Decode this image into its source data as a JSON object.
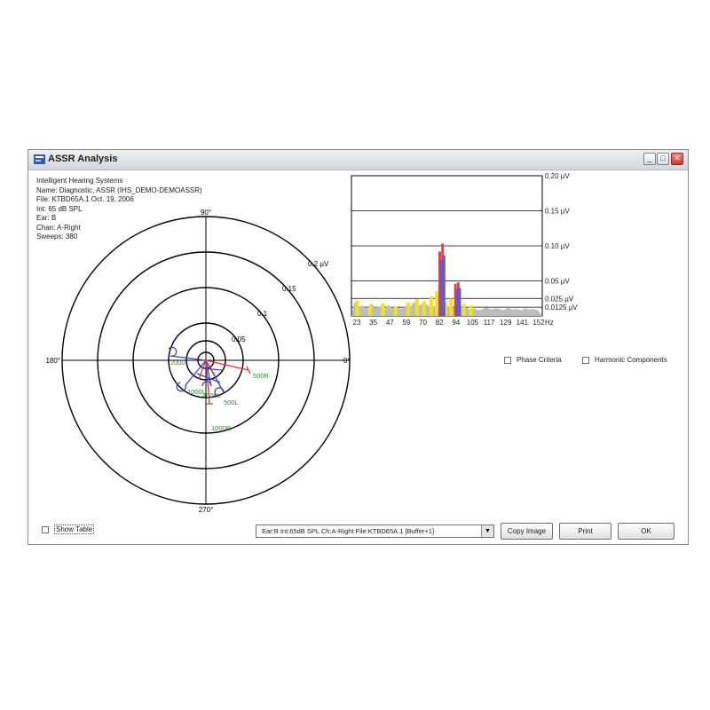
{
  "window": {
    "title": "ASSR Analysis",
    "minimize": "_",
    "maximize": "□",
    "close": "✕"
  },
  "info_lines": [
    "Intelligent Hearing Systems",
    "Name: Diagnostic, ASSR (IHS_DEMO-DEMOASSR)",
    "File: KTBD65A.1 Oct. 19, 2006",
    "Int: 65 dB SPL",
    "Ear: B",
    "Chan: A-Right",
    "Sweeps: 380"
  ],
  "polar": {
    "angle_labels": {
      "top": "90°",
      "left": "180°",
      "right": "0°",
      "bottom": "270°"
    },
    "ring_labels": [
      "0.05",
      "0.1",
      "0.15",
      "0.2 µV"
    ],
    "vector_labels": [
      {
        "text": "2000L",
        "color": "#2e8b2e"
      },
      {
        "text": "500R",
        "color": "#2e8b2e"
      },
      {
        "text": "1000L",
        "color": "#2e8b2e"
      },
      {
        "text": "4000L",
        "color": "#2e8b2e"
      },
      {
        "text": "500L",
        "color": "#2e8b2e"
      },
      {
        "text": "1000R",
        "color": "#2e8b2e"
      }
    ]
  },
  "chart_data": {
    "type": "bar",
    "x_tick_labels": [
      "23",
      "35",
      "47",
      "59",
      "70",
      "82",
      "94",
      "105",
      "117",
      "129",
      "141",
      "152"
    ],
    "x_unit": "Hz",
    "y_tick_labels": [
      "0.20 µV",
      "0.15 µV",
      "0.10 µV",
      "0.05 µV",
      "0.025 µV",
      "0.0125 µV"
    ],
    "ylim": [
      0,
      0.2
    ],
    "grid": true,
    "series": [
      {
        "values_hz": [
          82,
          84,
          93,
          95
        ],
        "values": [
          0.092,
          0.103,
          0.046,
          0.048
        ]
      },
      {
        "values_hz": [
          83,
          85,
          94,
          96
        ],
        "values": [
          0.08,
          0.086,
          0.038,
          0.04
        ]
      }
    ],
    "noise_floor": [
      [
        22,
        0.02
      ],
      [
        25,
        0.012
      ],
      [
        28,
        0.015
      ],
      [
        31,
        0.01
      ],
      [
        34,
        0.018
      ],
      [
        37,
        0.012
      ],
      [
        40,
        0.014
      ],
      [
        43,
        0.009
      ],
      [
        46,
        0.016
      ],
      [
        49,
        0.011
      ],
      [
        52,
        0.013
      ],
      [
        55,
        0.01
      ],
      [
        58,
        0.015
      ],
      [
        61,
        0.012
      ],
      [
        64,
        0.02
      ],
      [
        67,
        0.014
      ],
      [
        70,
        0.018
      ],
      [
        73,
        0.016
      ],
      [
        76,
        0.012
      ],
      [
        79,
        0.015
      ],
      [
        82,
        0.017
      ],
      [
        85,
        0.012
      ],
      [
        88,
        0.014
      ],
      [
        91,
        0.011
      ],
      [
        94,
        0.013
      ],
      [
        97,
        0.01
      ],
      [
        100,
        0.012
      ],
      [
        103,
        0.009
      ],
      [
        106,
        0.011
      ],
      [
        109,
        0.008
      ],
      [
        112,
        0.01
      ],
      [
        115,
        0.012
      ],
      [
        118,
        0.009
      ],
      [
        121,
        0.011
      ],
      [
        124,
        0.01
      ],
      [
        127,
        0.008
      ],
      [
        130,
        0.012
      ],
      [
        133,
        0.009
      ],
      [
        136,
        0.01
      ],
      [
        139,
        0.008
      ],
      [
        142,
        0.011
      ],
      [
        145,
        0.009
      ],
      [
        148,
        0.01
      ],
      [
        151,
        0.008
      ]
    ],
    "yellow_spikes": [
      [
        24,
        0.022
      ],
      [
        33,
        0.016
      ],
      [
        42,
        0.018
      ],
      [
        51,
        0.014
      ],
      [
        60,
        0.019
      ],
      [
        66,
        0.024
      ],
      [
        71,
        0.021
      ],
      [
        76,
        0.028
      ],
      [
        80,
        0.035
      ],
      [
        86,
        0.02
      ],
      [
        90,
        0.025
      ],
      [
        99,
        0.017
      ],
      [
        104,
        0.015
      ]
    ],
    "colors": {
      "red": "#e8424d",
      "blue": "#5a5ec8",
      "yellow": "#f2e21a",
      "noise": "#bdbdbd"
    }
  },
  "options": {
    "phase_criteria": "Phase Criteria",
    "harmonic_components": "Harmonic Components",
    "show_table": "Show Table"
  },
  "bottom": {
    "selection": "Ear:B Int:65dB SPL Ch:A-Right  File:KTBD65A.1  [Buffer+1]",
    "copy_image": "Copy Image",
    "print": "Print",
    "ok": "OK"
  }
}
